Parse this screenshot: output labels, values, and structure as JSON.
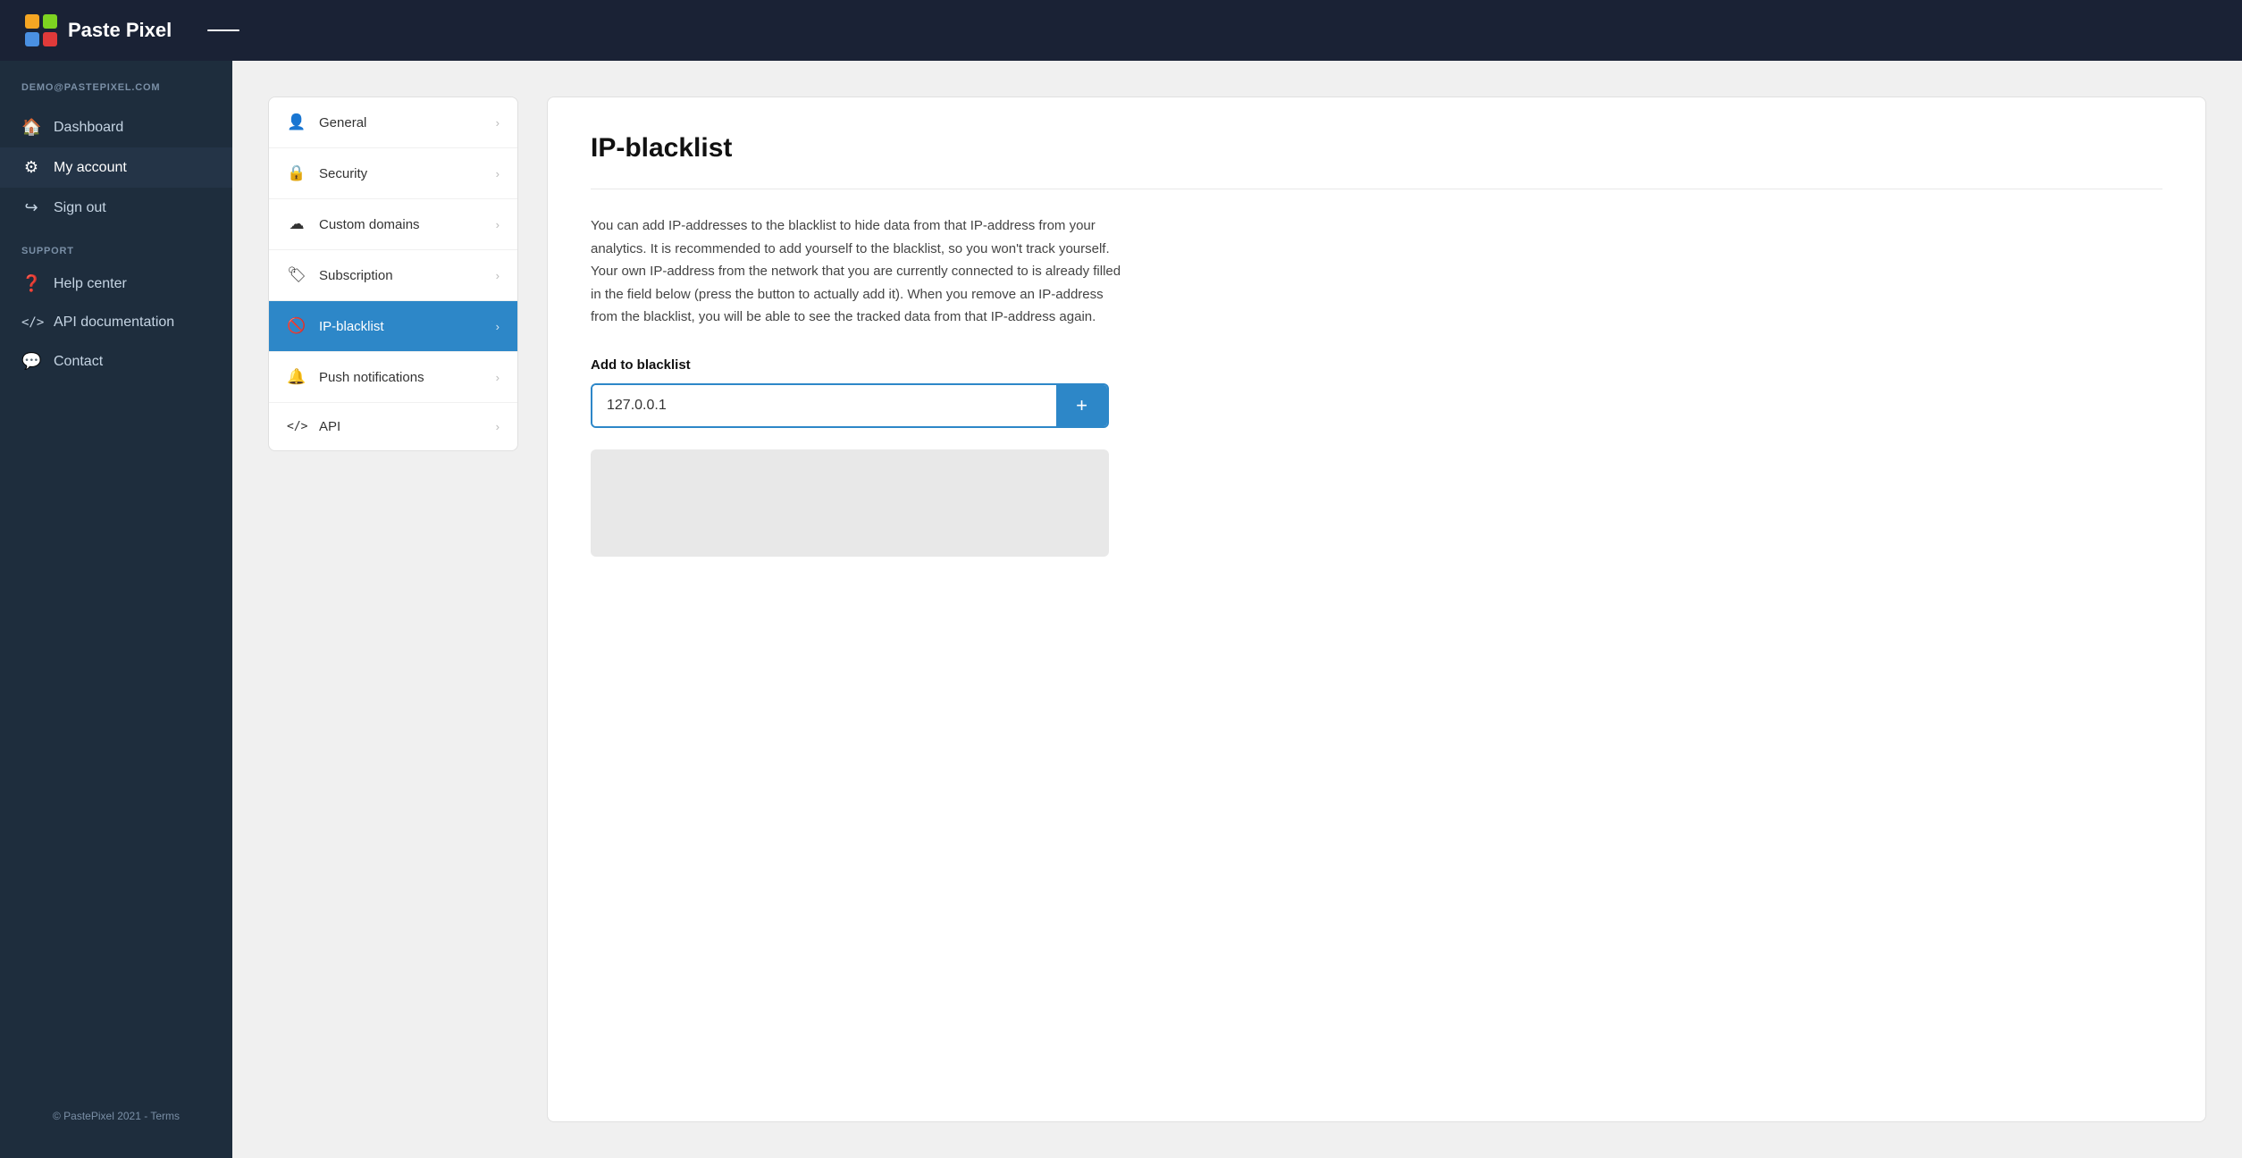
{
  "topbar": {
    "title": "Paste Pixel",
    "logo_alt": "Paste Pixel logo"
  },
  "sidebar": {
    "user_email": "DEMO@PASTEPIXEL.COM",
    "nav_items": [
      {
        "id": "dashboard",
        "label": "Dashboard",
        "icon": "🏠",
        "active": false
      },
      {
        "id": "my-account",
        "label": "My account",
        "icon": "⚙",
        "active": true
      },
      {
        "id": "sign-out",
        "label": "Sign out",
        "icon": "↪",
        "active": false
      }
    ],
    "support_section_label": "SUPPORT",
    "support_items": [
      {
        "id": "help-center",
        "label": "Help center",
        "icon": "❓"
      },
      {
        "id": "api-docs",
        "label": "API documentation",
        "icon": "</>"
      },
      {
        "id": "contact",
        "label": "Contact",
        "icon": "💬"
      }
    ],
    "footer": "© PastePixel 2021 - Terms"
  },
  "settings_menu": {
    "items": [
      {
        "id": "general",
        "label": "General",
        "icon": "👤",
        "active": false
      },
      {
        "id": "security",
        "label": "Security",
        "icon": "🔒",
        "active": false
      },
      {
        "id": "custom-domains",
        "label": "Custom domains",
        "icon": "☁",
        "active": false
      },
      {
        "id": "subscription",
        "label": "Subscription",
        "icon": "🏷",
        "active": false
      },
      {
        "id": "ip-blacklist",
        "label": "IP-blacklist",
        "icon": "🚫",
        "active": true
      },
      {
        "id": "push-notifications",
        "label": "Push notifications",
        "icon": "🔔",
        "active": false
      },
      {
        "id": "api",
        "label": "API",
        "icon": "</>",
        "active": false
      }
    ]
  },
  "main": {
    "page_title": "IP-blacklist",
    "description": "You can add IP-addresses to the blacklist to hide data from that IP-address from your analytics. It is recommended to add yourself to the blacklist, so you won't track yourself. Your own IP-address from the network that you are currently connected to is already filled in the field below (press the button to actually add it). When you remove an IP-address from the blacklist, you will be able to see the tracked data from that IP-address again.",
    "add_label": "Add to blacklist",
    "ip_value": "127.0.0.1",
    "add_btn_label": "+"
  }
}
